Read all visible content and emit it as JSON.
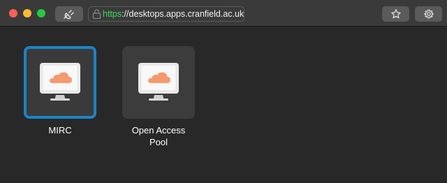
{
  "toolbar": {
    "url_scheme": "https",
    "url_rest": "://desktops.apps.cranfield.ac.uk",
    "buttons": [
      "plug-icon",
      "star-icon",
      "gear-icon"
    ]
  },
  "desktops": [
    {
      "label": "MIRC",
      "selected": true,
      "icon": "desktop-cloud-icon"
    },
    {
      "label_line1": "Open Access",
      "label_line2": "Pool",
      "selected": false,
      "icon": "desktop-cloud-icon"
    }
  ],
  "colors": {
    "background": "#282828",
    "titlebar": "#3a3a3a",
    "selection_border": "#1b84c6",
    "url_scheme": "#3ddc5c",
    "cloud": "#f59a6e"
  }
}
